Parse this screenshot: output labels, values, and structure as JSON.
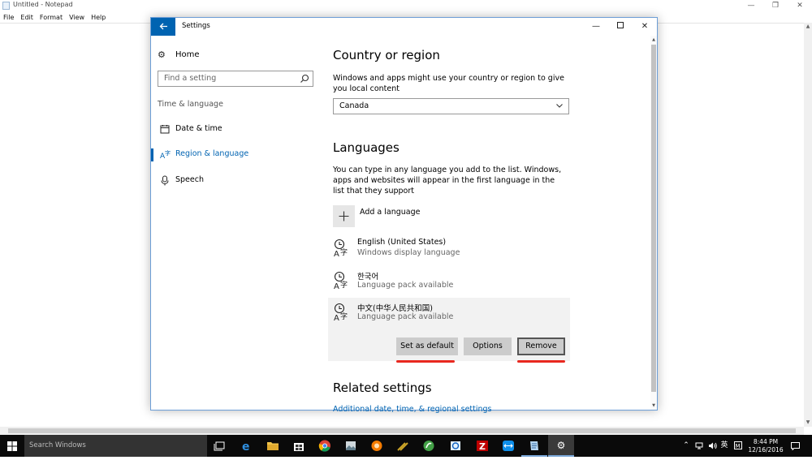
{
  "notepad": {
    "title": "Untitled - Notepad",
    "menu": [
      "File",
      "Edit",
      "Format",
      "View",
      "Help"
    ]
  },
  "settings": {
    "title": "Settings",
    "nav": {
      "home": "Home",
      "search_placeholder": "Find a setting",
      "section": "Time & language",
      "items": [
        {
          "label": "Date & time",
          "icon": "calendar-icon",
          "active": false
        },
        {
          "label": "Region & language",
          "icon": "region-language-icon",
          "active": true
        },
        {
          "label": "Speech",
          "icon": "microphone-icon",
          "active": false
        }
      ]
    },
    "country": {
      "heading": "Country or region",
      "description": "Windows and apps might use your country or region to give you local content",
      "selected": "Canada"
    },
    "languages": {
      "heading": "Languages",
      "description": "You can type in any language you add to the list. Windows, apps and websites will appear in the first language in the list that they support",
      "add_label": "Add a language",
      "list": [
        {
          "name": "English (United States)",
          "status": "Windows display language"
        },
        {
          "name": "한국어",
          "status": "Language pack available"
        },
        {
          "name": "中文(中华人民共和国)",
          "status": "Language pack available"
        }
      ],
      "buttons": {
        "set_default": "Set as default",
        "options": "Options",
        "remove": "Remove"
      }
    },
    "related": {
      "heading": "Related settings",
      "link": "Additional date, time, & regional settings"
    }
  },
  "taskbar": {
    "search_placeholder": "Search Windows",
    "ime": "英",
    "time": "8:44 PM",
    "date": "12/16/2016"
  },
  "colors": {
    "accent": "#0063b1",
    "annotation": "#e8281f",
    "button": "#cccccc"
  }
}
